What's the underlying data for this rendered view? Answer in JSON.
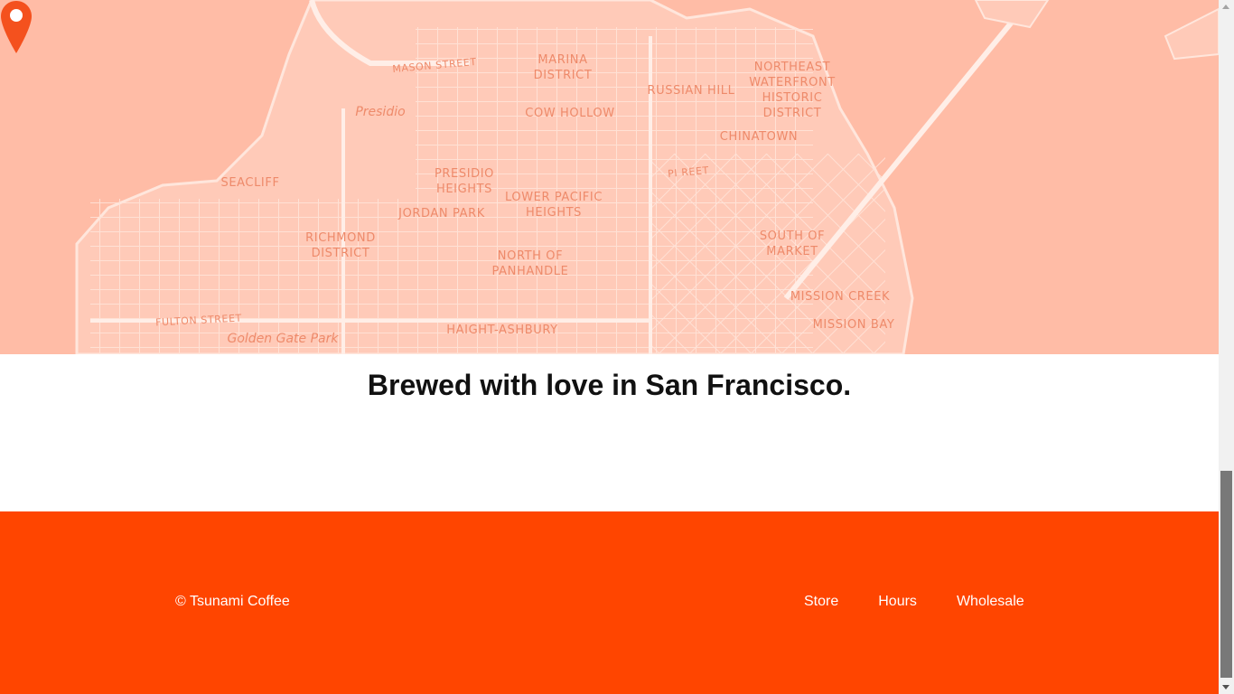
{
  "map": {
    "neighborhoods": [
      {
        "id": "marina",
        "label": "MARINA\nDISTRICT"
      },
      {
        "id": "russian-hill",
        "label": "RUSSIAN HILL"
      },
      {
        "id": "northeast-waterfront",
        "label": "NORTHEAST\nWATERFRONT\nHISTORIC\nDISTRICT"
      },
      {
        "id": "presidio",
        "label": "Presidio"
      },
      {
        "id": "cow-hollow",
        "label": "COW HOLLOW"
      },
      {
        "id": "chinatown",
        "label": "CHINATOWN"
      },
      {
        "id": "seacliff",
        "label": "SEACLIFF"
      },
      {
        "id": "presidio-heights",
        "label": "PRESIDIO\nHEIGHTS"
      },
      {
        "id": "lower-pacific-heights",
        "label": "LOWER PACIFIC\nHEIGHTS"
      },
      {
        "id": "jordan-park",
        "label": "JORDAN PARK"
      },
      {
        "id": "richmond",
        "label": "RICHMOND\nDISTRICT"
      },
      {
        "id": "south-of-market",
        "label": "SOUTH OF\nMARKET"
      },
      {
        "id": "north-of-panhandle",
        "label": "NORTH OF\nPANHANDLE"
      },
      {
        "id": "mission-creek",
        "label": "MISSION CREEK"
      },
      {
        "id": "mission-bay",
        "label": "MISSION BAY"
      },
      {
        "id": "haight-ashbury",
        "label": "HAIGHT-ASHBURY"
      },
      {
        "id": "golden-gate-park",
        "label": "Golden Gate Park"
      },
      {
        "id": "mason-street",
        "label": "MASON STREET"
      },
      {
        "id": "fulton-street",
        "label": "FULTON STREET"
      },
      {
        "id": "pine-street",
        "label": "PI     REET"
      }
    ],
    "colors": {
      "land": "#ffbca6",
      "streets": "#ffe9e0",
      "water": "#ffbca6",
      "label": "#ee8a6a",
      "pin": "#f4511e"
    }
  },
  "tagline": "Brewed with love in San Francisco.",
  "footer": {
    "copyright": "© Tsunami Coffee",
    "nav": [
      "Store",
      "Hours",
      "Wholesale"
    ],
    "background": "#ff4500"
  }
}
